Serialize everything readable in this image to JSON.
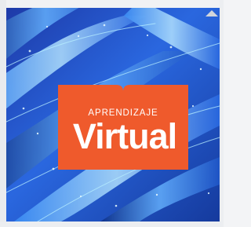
{
  "image": {
    "brand": {
      "kicker": "APRENDIZAJE",
      "headline": "Virtual",
      "badge_color": "#ef5a2c",
      "text_color": "#ffffff"
    },
    "background": {
      "theme": "blue abstract light streaks",
      "primary_color": "#2459d6",
      "accent_color": "#7fd3ff"
    }
  }
}
